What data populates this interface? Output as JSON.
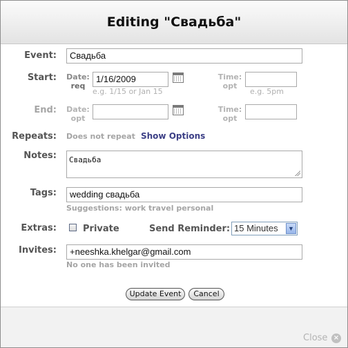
{
  "dialog": {
    "title": "Editing \"Свадьба\"",
    "close_label": "Close"
  },
  "form": {
    "event": {
      "label": "Event:",
      "value": "Свадьба"
    },
    "start": {
      "label": "Start:",
      "date_label": "Date:",
      "date_req": "req",
      "date_value": "1/16/2009",
      "date_hint": "e.g. 1/15 or Jan 15",
      "time_label": "Time:",
      "time_opt": "opt",
      "time_value": "",
      "time_hint": "e.g. 5pm"
    },
    "end": {
      "label": "End:",
      "date_label": "Date:",
      "date_opt": "opt",
      "date_value": "",
      "time_label": "Time:",
      "time_opt": "opt",
      "time_value": ""
    },
    "repeats": {
      "label": "Repeats:",
      "status": "Does not repeat",
      "link": "Show Options"
    },
    "notes": {
      "label": "Notes:",
      "value": "Свадьба"
    },
    "tags": {
      "label": "Tags:",
      "value": "wedding свадьба",
      "suggestions": "Suggestions: work travel personal"
    },
    "extras": {
      "label": "Extras:",
      "private_label": "Private",
      "private_checked": false,
      "reminder_label": "Send Reminder:",
      "reminder_value": "15 Minutes"
    },
    "invites": {
      "label": "Invites:",
      "value": "+neeshka.khelgar@gmail.com",
      "status": "No one has been invited"
    }
  },
  "buttons": {
    "update": "Update Event",
    "cancel": "Cancel"
  },
  "icons": {
    "calendar": "calendar-icon",
    "close": "close-icon",
    "dropdown": "chevron-down-icon"
  }
}
